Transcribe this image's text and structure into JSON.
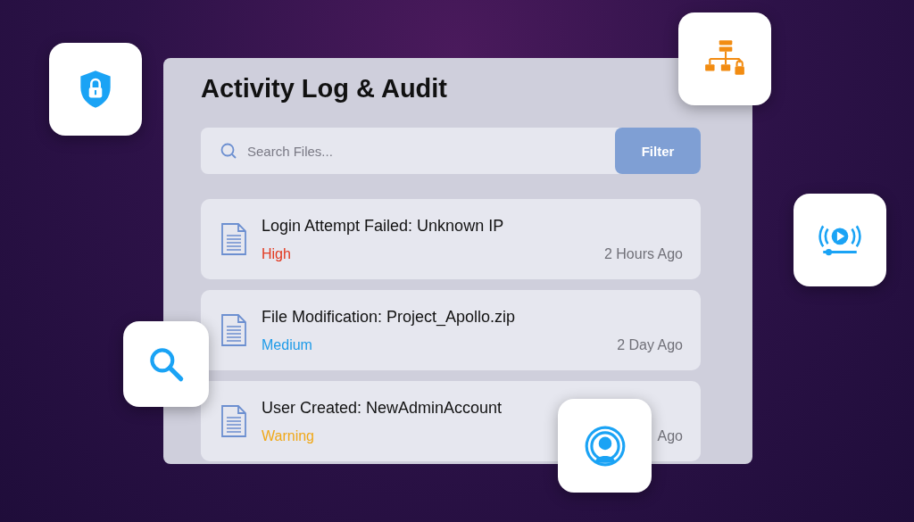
{
  "panel": {
    "title": "Activity Log & Audit"
  },
  "search": {
    "placeholder": "Search Files...",
    "button": "Filter"
  },
  "entries": [
    {
      "title": "Login Attempt Failed: Unknown IP",
      "severity": "High",
      "color": "#e2381f",
      "time": "2 Hours Ago"
    },
    {
      "title": "File Modification: Project_Apollo.zip",
      "severity": "Medium",
      "color": "#1e9be8",
      "time": "2 Day Ago"
    },
    {
      "title": "User Created: NewAdminAccount",
      "severity": "Warning",
      "color": "#f0a818",
      "time": "Ago"
    }
  ],
  "tiles": [
    {
      "kind": "shield"
    },
    {
      "kind": "network"
    },
    {
      "kind": "media"
    },
    {
      "kind": "search"
    },
    {
      "kind": "user"
    }
  ]
}
